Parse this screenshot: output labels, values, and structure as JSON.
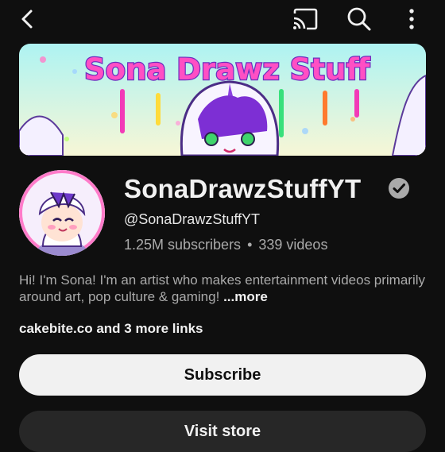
{
  "header": {
    "back_icon": "back-arrow-icon",
    "cast_icon": "cast-icon",
    "search_icon": "search-icon",
    "more_icon": "more-vert-icon"
  },
  "banner": {
    "text": "Sona Drawz Stuff"
  },
  "channel": {
    "name": "SonaDrawzStuffYT",
    "handle": "@SonaDrawzStuffYT",
    "subscribers": "1.25M subscribers",
    "separator": "•",
    "videos": "339 videos",
    "description": "Hi! I'm Sona! I'm an artist who makes entertainment videos primarily around art, pop culture & gaming!",
    "more_label": "...more",
    "links": "cakebite.co and 3 more links"
  },
  "actions": {
    "subscribe_label": "Subscribe",
    "visit_store_label": "Visit store"
  },
  "colors": {
    "background": "#0f0f0f",
    "text_primary": "#f1f1f1",
    "text_secondary": "#aaaaaa",
    "subscribe_bg": "#f1f1f1",
    "store_bg": "#272727"
  }
}
